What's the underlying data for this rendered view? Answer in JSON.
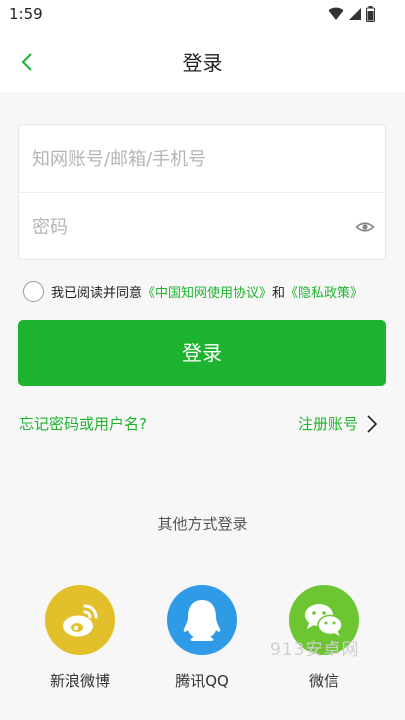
{
  "status_bar": {
    "time": "1:59",
    "icons": [
      "wifi-icon",
      "signal-icon",
      "battery-icon"
    ]
  },
  "header": {
    "title": "登录",
    "back_icon": "chevron-left-icon"
  },
  "form": {
    "account_placeholder": "知网账号/邮箱/手机号",
    "account_value": "",
    "password_placeholder": "密码",
    "password_value": "",
    "eye_icon": "eye-icon"
  },
  "agreement": {
    "checked": false,
    "prefix": "我已阅读并同意",
    "link1": "《中国知网使用协议》",
    "conj": "和",
    "link2": "《隐私政策》"
  },
  "login_button": {
    "label": "登录"
  },
  "links": {
    "forgot": "忘记密码或用户名?",
    "register": "注册账号",
    "register_icon": "chevron-right-icon"
  },
  "other_login": {
    "title": "其他方式登录",
    "providers": [
      {
        "label": "新浪微博",
        "icon": "weibo-icon",
        "color": "#e2c02b"
      },
      {
        "label": "腾讯QQ",
        "icon": "qq-icon",
        "color": "#2f9be6"
      },
      {
        "label": "微信",
        "icon": "wechat-icon",
        "color": "#6cc531"
      }
    ]
  },
  "watermark": "913安卓网",
  "colors": {
    "accent": "#1db32f",
    "link": "#1fb32e",
    "background": "#f7f7f7"
  }
}
